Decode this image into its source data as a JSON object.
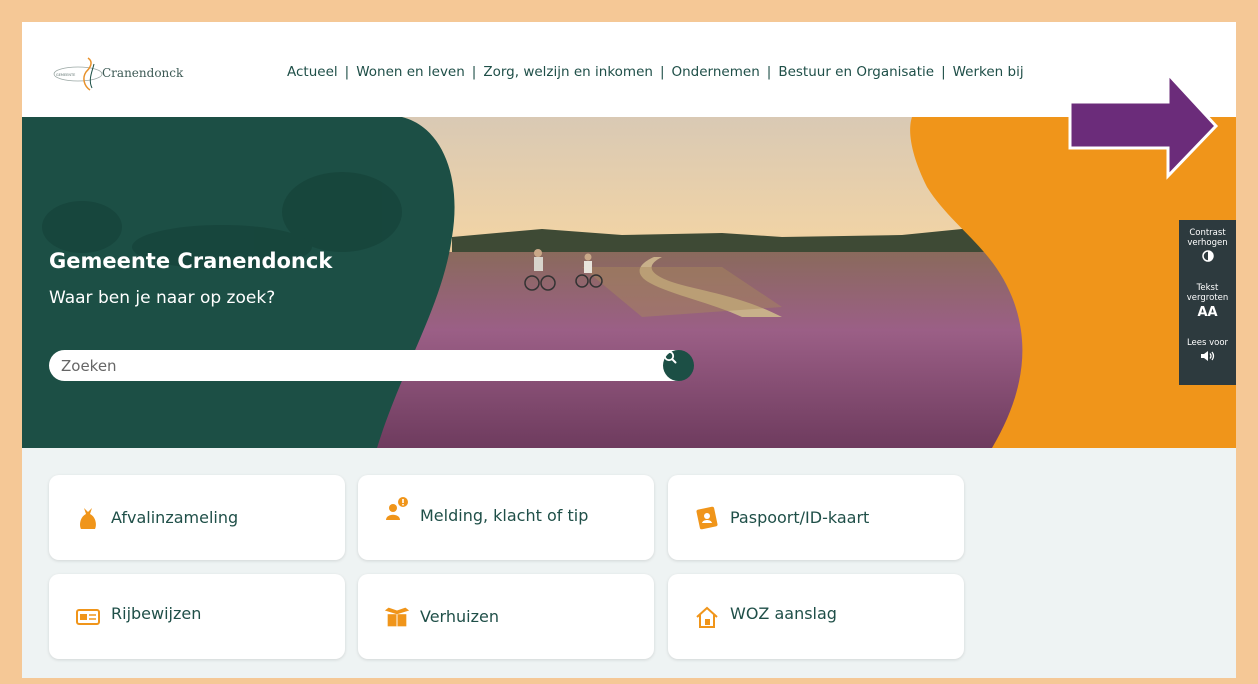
{
  "logo": {
    "small_text": "GEMEENTE",
    "name": "Cranendonck"
  },
  "nav": {
    "items": [
      "Actueel",
      "Wonen en leven",
      "Zorg, welzijn en inkomen",
      "Ondernemen",
      "Bestuur en Organisatie",
      "Werken bij"
    ],
    "separator": "|"
  },
  "hero": {
    "title": "Gemeente Cranendonck",
    "subtitle": "Waar ben je naar op zoek?",
    "search_placeholder": "Zoeken"
  },
  "accessibility": {
    "contrast_line1": "Contrast",
    "contrast_line2": "verhogen",
    "contrast_icon": "half-circle-icon",
    "text_line1": "Tekst",
    "text_line2": "vergroten",
    "text_icon": "AA",
    "read_label": "Lees voor",
    "read_icon": "speaker-icon"
  },
  "cards": [
    {
      "label": "Afvalinzameling",
      "icon": "waste-bag-icon"
    },
    {
      "label": "Melding, klacht of tip",
      "icon": "notification-person-icon"
    },
    {
      "label": "Paspoort/ID-kaart",
      "icon": "passport-icon"
    },
    {
      "label": "Rijbewijzen",
      "icon": "license-card-icon"
    },
    {
      "label": "Verhuizen",
      "icon": "moving-box-icon"
    },
    {
      "label": "WOZ aanslag",
      "icon": "house-icon"
    }
  ],
  "colors": {
    "brand_green": "#1c4f45",
    "brand_orange": "#f0951a",
    "page_border": "#f5c896",
    "annotation_arrow": "#6b2c7a"
  }
}
